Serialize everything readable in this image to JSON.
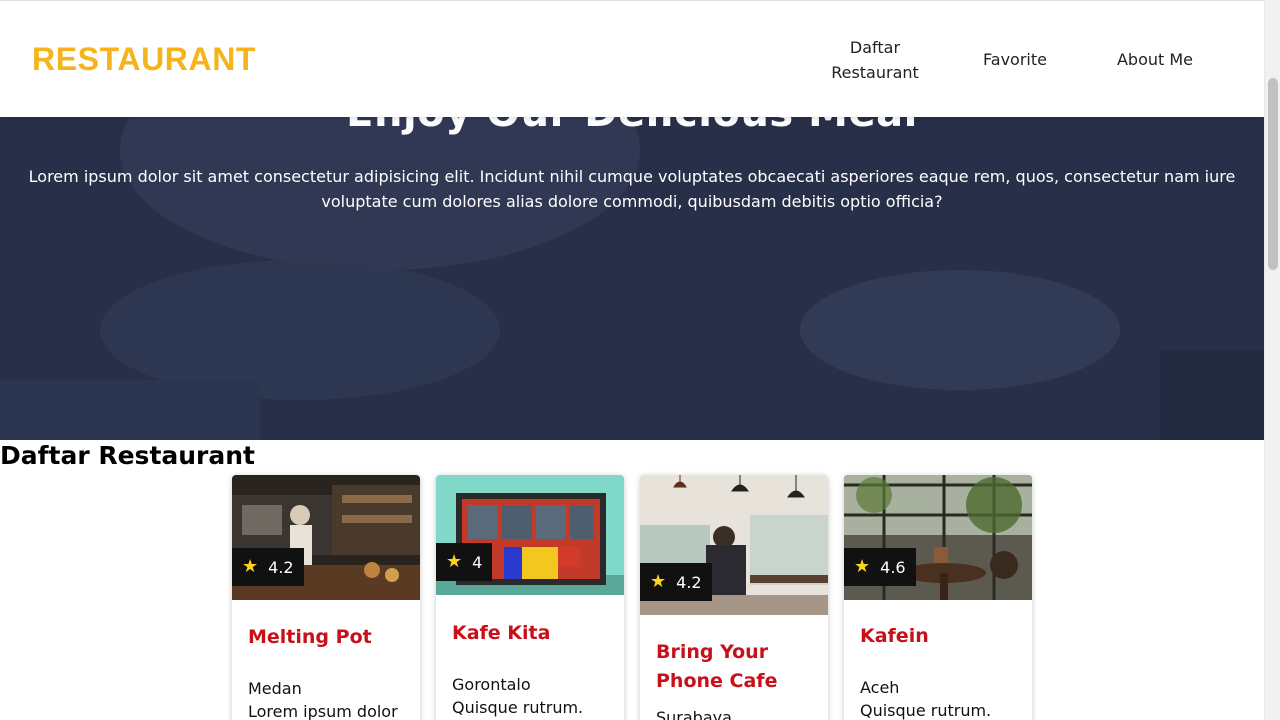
{
  "header": {
    "brand": "RESTAURANT",
    "nav": [
      "Daftar\nRestaurant",
      "Favorite",
      "About Me"
    ]
  },
  "hero": {
    "title": "Enjoy Our Delicious Meal",
    "text": "Lorem ipsum dolor sit amet consectetur adipisicing elit. Incidunt nihil cumque voluptates obcaecati asperiores eaque rem, quos, consectetur nam iure voluptate cum dolores alias dolore commodi, quibusdam debitis optio officia?"
  },
  "section": {
    "title": "Daftar Restaurant"
  },
  "restaurants": [
    {
      "name": "Melting Pot",
      "rating": "4.2",
      "city": "Medan",
      "desc": "Lorem ipsum dolor"
    },
    {
      "name": "Kafe Kita",
      "rating": "4",
      "city": "Gorontalo",
      "desc": "Quisque rutrum."
    },
    {
      "name": "Bring Your Phone Cafe",
      "rating": "4.2",
      "city": "Surabaya",
      "desc": ""
    },
    {
      "name": "Kafein",
      "rating": "4.6",
      "city": "Aceh",
      "desc": "Quisque rutrum."
    }
  ],
  "colors": {
    "brand": "#f5b41b",
    "hero_overlay": "#283049",
    "card_title": "#c8101a",
    "rating_bg": "#111111",
    "star": "#ffd21f"
  },
  "icons": {
    "rating": "star-icon"
  }
}
